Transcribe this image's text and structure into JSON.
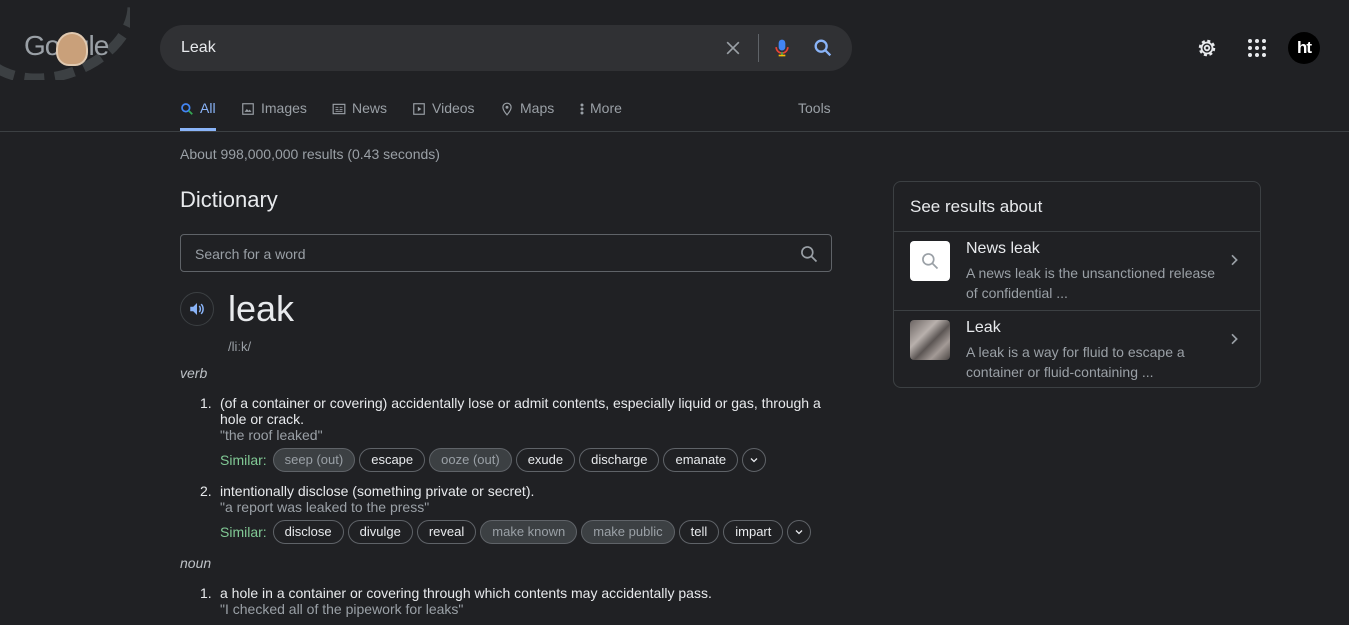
{
  "search": {
    "query": "Leak"
  },
  "header": {
    "logo_text": "Google",
    "avatar_text": "ht"
  },
  "tabs": [
    {
      "label": "All",
      "icon": "search-icon",
      "active": true
    },
    {
      "label": "Images",
      "icon": "image-icon"
    },
    {
      "label": "News",
      "icon": "news-icon"
    },
    {
      "label": "Videos",
      "icon": "video-icon"
    },
    {
      "label": "Maps",
      "icon": "map-pin-icon"
    },
    {
      "label": "More",
      "icon": "more-vert-icon"
    }
  ],
  "tools_label": "Tools",
  "stats": "About 998,000,000 results (0.43 seconds)",
  "dictionary": {
    "title": "Dictionary",
    "search_placeholder": "Search for a word",
    "word": "leak",
    "phonetic": "/liːk/",
    "verb": {
      "pos": "verb",
      "defs": [
        {
          "num": "1.",
          "text": "(of a container or covering) accidentally lose or admit contents, especially liquid or gas, through a hole or crack.",
          "example": "\"the roof leaked\"",
          "similar_label": "Similar:",
          "similar": [
            {
              "word": "seep (out)",
              "dim": true
            },
            {
              "word": "escape"
            },
            {
              "word": "ooze (out)",
              "dim": true
            },
            {
              "word": "exude"
            },
            {
              "word": "discharge"
            },
            {
              "word": "emanate"
            }
          ]
        },
        {
          "num": "2.",
          "text": "intentionally disclose (something private or secret).",
          "example": "\"a report was leaked to the press\"",
          "similar_label": "Similar:",
          "similar": [
            {
              "word": "disclose"
            },
            {
              "word": "divulge"
            },
            {
              "word": "reveal"
            },
            {
              "word": "make known",
              "dim": true
            },
            {
              "word": "make public",
              "dim": true
            },
            {
              "word": "tell"
            },
            {
              "word": "impart"
            }
          ]
        }
      ]
    },
    "noun": {
      "pos": "noun",
      "defs": [
        {
          "num": "1.",
          "text": "a hole in a container or covering through which contents may accidentally pass.",
          "example": "\"I checked all of the pipework for leaks\""
        }
      ]
    }
  },
  "see_results": {
    "title": "See results about",
    "items": [
      {
        "name": "News leak",
        "desc": "A news leak is the unsanctioned release of confidential ...",
        "thumb": "search-icon"
      },
      {
        "name": "Leak",
        "desc": "A leak is a way for fluid to escape a container or fluid-containing ...",
        "thumb": "photo"
      }
    ]
  },
  "colors": {
    "background": "#202124",
    "accent": "#8ab4f8",
    "similar": "#81c995"
  }
}
